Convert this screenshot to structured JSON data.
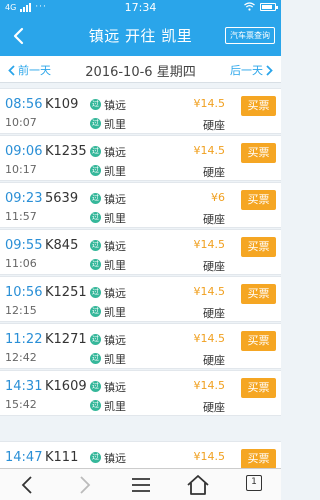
{
  "status_bar": {
    "network": "4G",
    "dots": "···",
    "time": "17:34"
  },
  "header": {
    "title": "镇远 开往 凯里",
    "bus_button": "汽车票查询"
  },
  "date_bar": {
    "prev_label": "前一天",
    "date": "2016-10-6 星期四",
    "next_label": "后一天"
  },
  "trains": [
    {
      "dep_time": "08:56",
      "arr_time": "10:07",
      "train_no": "K109",
      "dep_station": "镇远",
      "arr_station": "凯里",
      "dep_tag": "过",
      "arr_tag": "过",
      "price": "¥14.5",
      "seat": "硬座",
      "buy_label": "买票"
    },
    {
      "dep_time": "09:06",
      "arr_time": "10:17",
      "train_no": "K1235",
      "dep_station": "镇远",
      "arr_station": "凯里",
      "dep_tag": "过",
      "arr_tag": "过",
      "price": "¥14.5",
      "seat": "硬座",
      "buy_label": "买票"
    },
    {
      "dep_time": "09:23",
      "arr_time": "11:57",
      "train_no": "5639",
      "dep_station": "镇远",
      "arr_station": "凯里",
      "dep_tag": "过",
      "arr_tag": "过",
      "price": "¥6",
      "seat": "硬座",
      "buy_label": "买票"
    },
    {
      "dep_time": "09:55",
      "arr_time": "11:06",
      "train_no": "K845",
      "dep_station": "镇远",
      "arr_station": "凯里",
      "dep_tag": "过",
      "arr_tag": "过",
      "price": "¥14.5",
      "seat": "硬座",
      "buy_label": "买票"
    },
    {
      "dep_time": "10:56",
      "arr_time": "12:15",
      "train_no": "K1251",
      "dep_station": "镇远",
      "arr_station": "凯里",
      "dep_tag": "过",
      "arr_tag": "过",
      "price": "¥14.5",
      "seat": "硬座",
      "buy_label": "买票"
    },
    {
      "dep_time": "11:22",
      "arr_time": "12:42",
      "train_no": "K1271",
      "dep_station": "镇远",
      "arr_station": "凯里",
      "dep_tag": "过",
      "arr_tag": "过",
      "price": "¥14.5",
      "seat": "硬座",
      "buy_label": "买票"
    },
    {
      "dep_time": "14:31",
      "arr_time": "15:42",
      "train_no": "K1609",
      "dep_station": "镇远",
      "arr_station": "凯里",
      "dep_tag": "过",
      "arr_tag": "过",
      "price": "¥14.5",
      "seat": "硬座",
      "buy_label": "买票"
    },
    {
      "dep_time": "14:47",
      "arr_time": "",
      "train_no": "K111",
      "dep_station": "镇远",
      "arr_station": "",
      "dep_tag": "过",
      "arr_tag": "",
      "price": "¥14.5",
      "seat": "",
      "buy_label": "买票"
    }
  ],
  "bottom_nav": {
    "tab_count": "1"
  },
  "colors": {
    "primary": "#2aa5ea",
    "time": "#2a8fd6",
    "price": "#f0a020",
    "buy": "#f5a623",
    "tag": "#35b79a"
  },
  "icons": [
    "back-icon",
    "chevron-left-icon",
    "chevron-right-icon",
    "menu-icon",
    "home-icon",
    "wifi-icon",
    "battery-icon"
  ]
}
